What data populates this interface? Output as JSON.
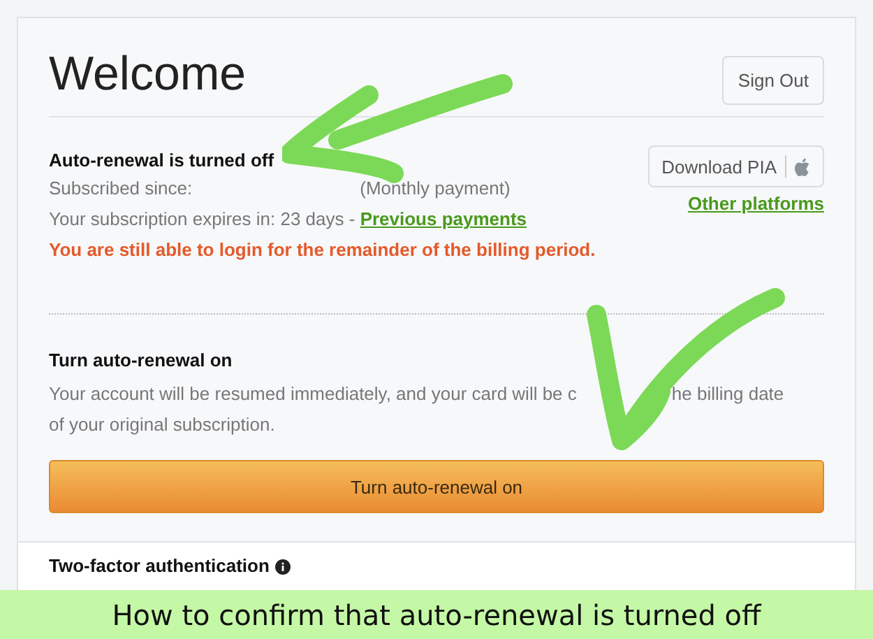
{
  "header": {
    "title": "Welcome",
    "sign_out": "Sign Out"
  },
  "status": {
    "heading": "Auto-renewal is turned off",
    "subscribed_label": "Subscribed since:",
    "payment_type": "(Monthly payment)",
    "expires": "Your subscription expires in: 23 days - ",
    "payments_link": "Previous payments",
    "notice": "You are still able to login for the remainder of the billing period."
  },
  "download": {
    "button": "Download PIA",
    "link": "Other platforms"
  },
  "renewal": {
    "heading": "Turn auto-renewal on",
    "text_before": "Your account will be resumed immediately, and your card will be c",
    "text_after": "he billing date",
    "text_line2": "of your original subscription.",
    "button": "Turn auto-renewal on"
  },
  "two_factor": {
    "heading": "Two-factor authentication"
  },
  "caption": "How to confirm that auto-renewal is turned off"
}
